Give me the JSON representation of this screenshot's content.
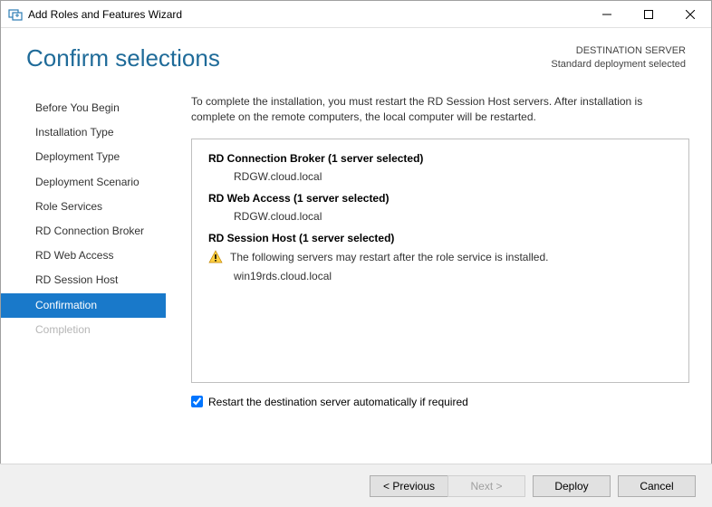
{
  "window": {
    "title": "Add Roles and Features Wizard"
  },
  "header": {
    "page_title": "Confirm selections",
    "dest_label": "DESTINATION SERVER",
    "dest_value": "Standard deployment selected"
  },
  "sidebar": {
    "items": [
      {
        "label": "Before You Begin",
        "state": "normal"
      },
      {
        "label": "Installation Type",
        "state": "normal"
      },
      {
        "label": "Deployment Type",
        "state": "normal"
      },
      {
        "label": "Deployment Scenario",
        "state": "normal"
      },
      {
        "label": "Role Services",
        "state": "normal"
      },
      {
        "label": "RD Connection Broker",
        "state": "normal"
      },
      {
        "label": "RD Web Access",
        "state": "normal"
      },
      {
        "label": "RD Session Host",
        "state": "normal"
      },
      {
        "label": "Confirmation",
        "state": "selected"
      },
      {
        "label": "Completion",
        "state": "disabled"
      }
    ]
  },
  "content": {
    "instruction": "To complete the installation, you must restart the RD Session Host servers. After installation is complete on the remote computers, the local computer will be restarted.",
    "sections": [
      {
        "heading": "RD Connection Broker  (1 server selected)",
        "server": "RDGW.cloud.local"
      },
      {
        "heading": "RD Web Access  (1 server selected)",
        "server": "RDGW.cloud.local"
      },
      {
        "heading": "RD Session Host  (1 server selected)",
        "warning": "The following servers may restart after the role service is installed.",
        "server": "win19rds.cloud.local"
      }
    ],
    "restart_checkbox_label": "Restart the destination server automatically if required",
    "restart_checked": true
  },
  "buttons": {
    "previous": "< Previous",
    "next": "Next >",
    "deploy": "Deploy",
    "cancel": "Cancel"
  }
}
